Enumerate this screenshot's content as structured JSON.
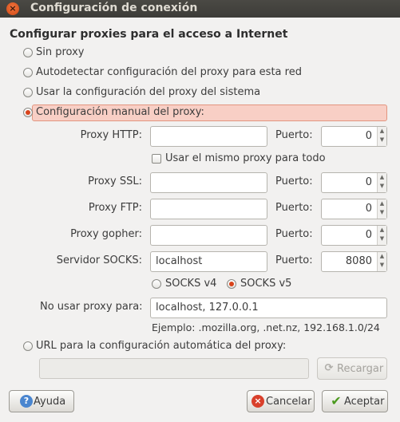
{
  "window": {
    "title": "Configuración de conexión"
  },
  "section_title": "Configurar proxies para el acceso a Internet",
  "options": {
    "no_proxy": "Sin proxy",
    "autodetect": "Autodetectar configuración del proxy para esta red",
    "system": "Usar la configuración del proxy del sistema",
    "manual": "Configuración manual del proxy:",
    "auto_url": "URL para la configuración automática del proxy:"
  },
  "selected_option": "manual",
  "manual": {
    "http_label": "Proxy HTTP:",
    "http_value": "",
    "http_port": "0",
    "same_proxy_label": "Usar el mismo proxy para todo",
    "same_proxy_checked": false,
    "ssl_label": "Proxy SSL:",
    "ssl_value": "",
    "ssl_port": "0",
    "ftp_label": "Proxy FTP:",
    "ftp_value": "",
    "ftp_port": "0",
    "gopher_label": "Proxy gopher:",
    "gopher_value": "",
    "gopher_port": "0",
    "socks_label": "Servidor SOCKS:",
    "socks_value": "localhost",
    "socks_port": "8080",
    "port_label": "Puerto:",
    "socks_v4": "SOCKS v4",
    "socks_v5": "SOCKS v5",
    "socks_version_selected": "v5",
    "no_proxy_label": "No usar proxy para:",
    "no_proxy_value": "localhost, 127.0.0.1",
    "example": "Ejemplo: .mozilla.org, .net.nz, 192.168.1.0/24"
  },
  "auto_url_value": "",
  "buttons": {
    "reload": "Recargar",
    "help": "Ayuda",
    "cancel": "Cancelar",
    "accept": "Aceptar"
  },
  "colors": {
    "selection_bg": "#f8cfc5",
    "radio_accent": "#d8431b",
    "titlebar": "#3d3c38"
  }
}
